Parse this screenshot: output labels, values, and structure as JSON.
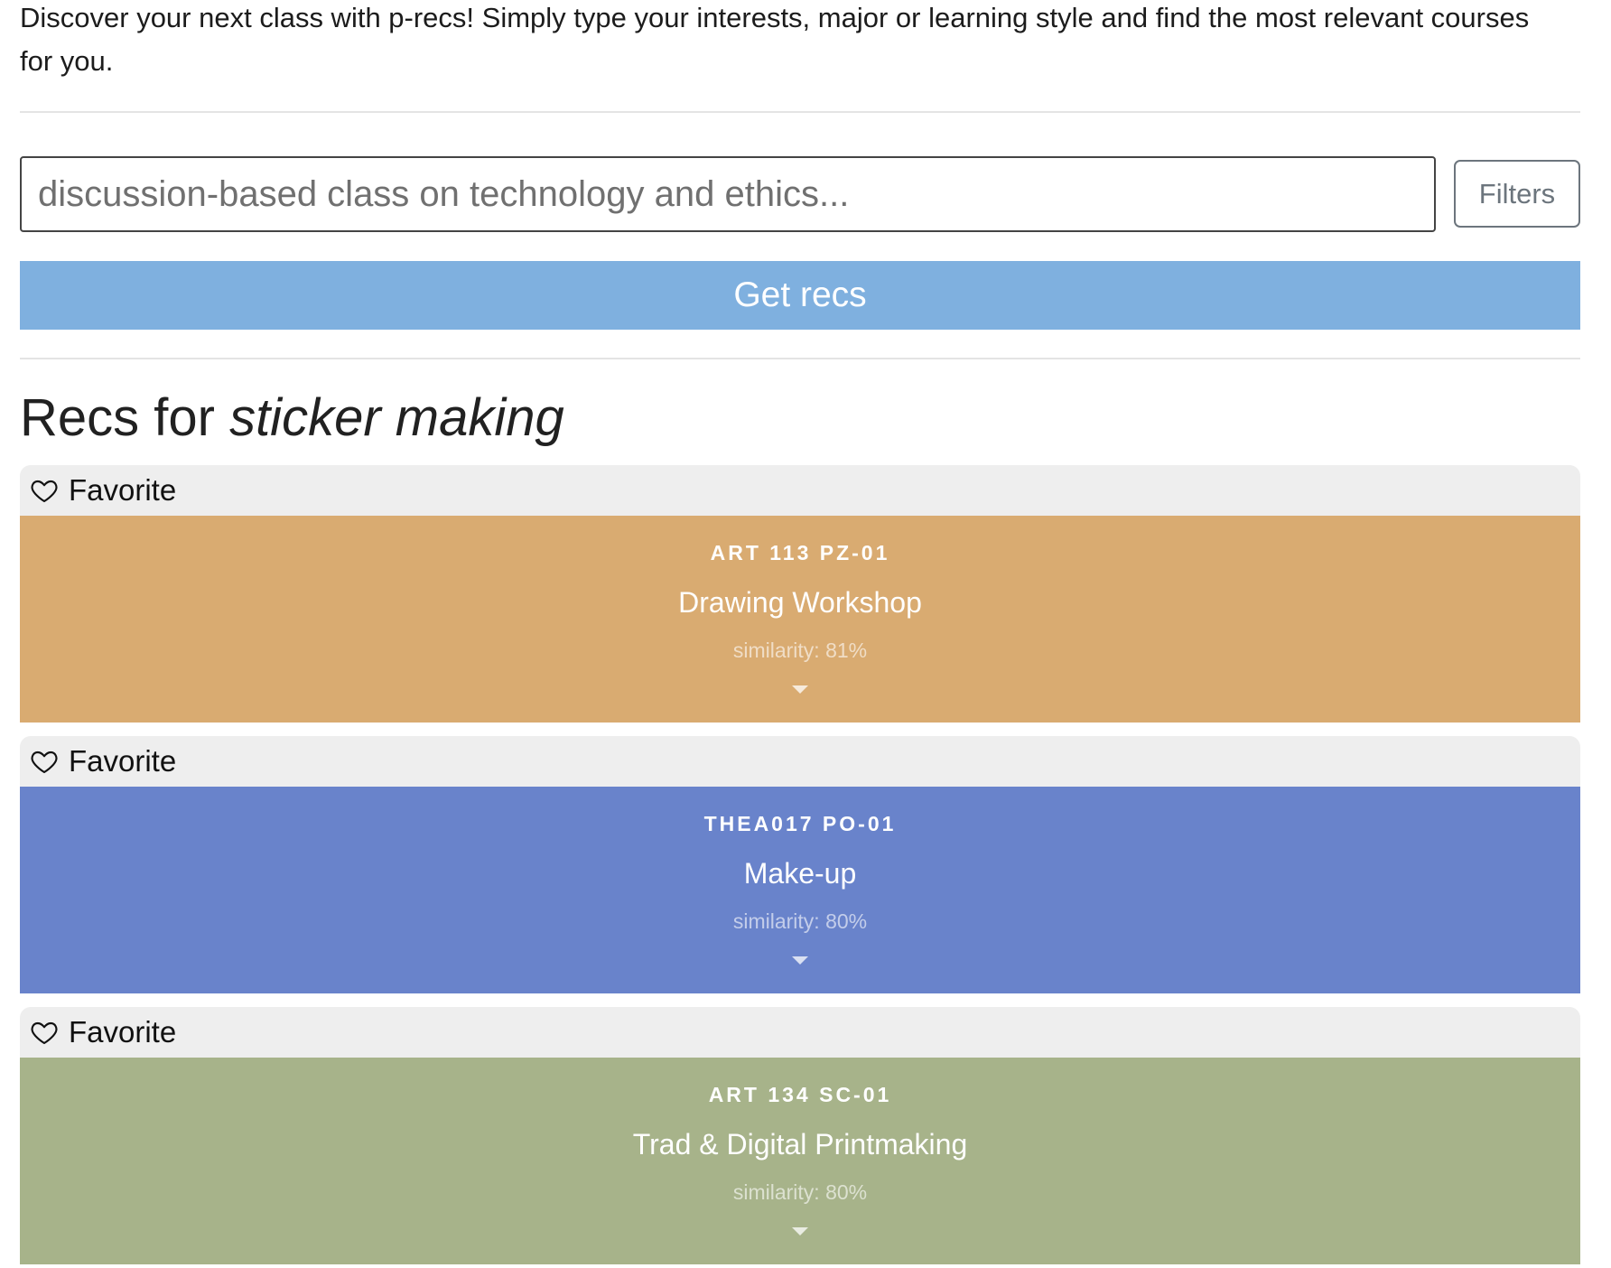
{
  "intro": {
    "text": "Discover your next class with p-recs! Simply type your interests, major or learning style and find the most relevant courses for you."
  },
  "search": {
    "value": "",
    "placeholder": "discussion-based class on technology and ethics..."
  },
  "filters": {
    "label": "Filters"
  },
  "get_recs": {
    "label": "Get recs"
  },
  "results": {
    "prefix": "Recs for ",
    "query": "sticker making"
  },
  "icons": {
    "favorite": "heart-outline-icon",
    "expand": "caret-down-icon"
  },
  "cards": [
    {
      "favorite_label": "Favorite",
      "code": "ART 113 PZ-01",
      "name": "Drawing Workshop",
      "similarity": "similarity: 81%",
      "color": "#d9ab71"
    },
    {
      "favorite_label": "Favorite",
      "code": "THEA017 PO-01",
      "name": "Make-up",
      "similarity": "similarity: 80%",
      "color": "#6983cb"
    },
    {
      "favorite_label": "Favorite",
      "code": "ART 134 SC-01",
      "name": "Trad & Digital Printmaking",
      "similarity": "similarity: 80%",
      "color": "#a7b38a"
    }
  ]
}
